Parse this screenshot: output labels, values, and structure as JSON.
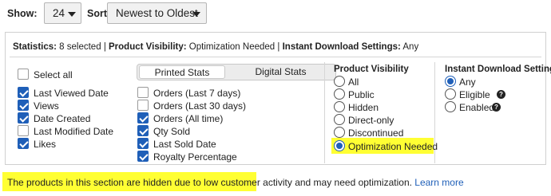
{
  "toolbar": {
    "show_label": "Show:",
    "show_value": "24",
    "sort_label": "Sort:",
    "sort_value": "Newest to Oldest"
  },
  "stats": {
    "statistics_label": "Statistics:",
    "statistics_value": "8 selected",
    "sep1": "|",
    "visibility_label": "Product Visibility:",
    "visibility_value": "Optimization Needed",
    "sep2": "|",
    "download_label": "Instant Download Settings:",
    "download_value": "Any"
  },
  "columns_left": [
    {
      "label": "Select all",
      "checked": false
    },
    {
      "label": "Last Viewed Date",
      "checked": true
    },
    {
      "label": "Views",
      "checked": true
    },
    {
      "label": "Date Created",
      "checked": true
    },
    {
      "label": "Last Modified Date",
      "checked": false
    },
    {
      "label": "Likes",
      "checked": true
    }
  ],
  "tabs": {
    "printed": "Printed Stats",
    "digital": "Digital Stats",
    "active": "printed"
  },
  "columns_middle": [
    {
      "label": "Orders (Last 7 days)",
      "checked": false
    },
    {
      "label": "Orders (Last 30 days)",
      "checked": false
    },
    {
      "label": "Orders (All time)",
      "checked": true
    },
    {
      "label": "Qty Sold",
      "checked": true
    },
    {
      "label": "Last Sold Date",
      "checked": true
    },
    {
      "label": "Royalty Percentage",
      "checked": true
    }
  ],
  "product_visibility": {
    "title": "Product Visibility",
    "options": [
      {
        "label": "All",
        "selected": false
      },
      {
        "label": "Public",
        "selected": false
      },
      {
        "label": "Hidden",
        "selected": false
      },
      {
        "label": "Direct-only",
        "selected": false
      },
      {
        "label": "Discontinued",
        "selected": false
      },
      {
        "label": "Optimization Needed",
        "selected": true
      }
    ]
  },
  "instant_download": {
    "title": "Instant Download Settings",
    "options": [
      {
        "label": "Any",
        "selected": true,
        "help": false
      },
      {
        "label": "Eligible",
        "selected": false,
        "help": true
      },
      {
        "label": "Enabled",
        "selected": false,
        "help": true
      }
    ],
    "help_glyph": "?"
  },
  "footer": {
    "highlighted": "The products in this section are hidden due to low customer activity",
    "rest": " and may need optimization. ",
    "link": "Learn more"
  },
  "colors": {
    "accent": "#1f5fb8",
    "highlight": "#ffff33"
  }
}
